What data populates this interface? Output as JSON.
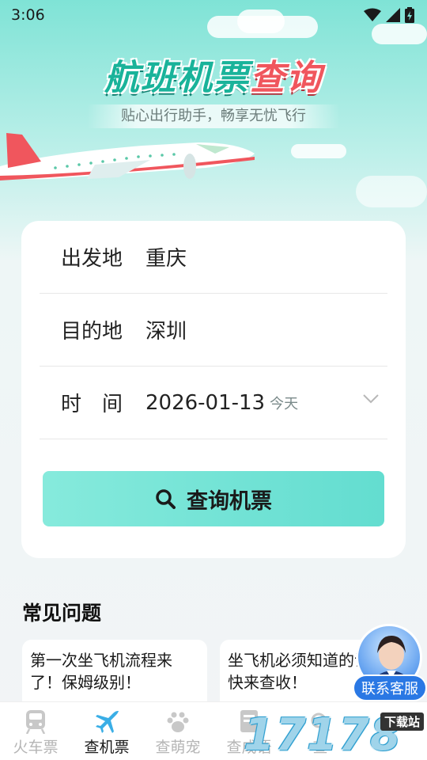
{
  "status_bar": {
    "time": "3:06"
  },
  "hero": {
    "title_part1": "航班机票",
    "title_part2": "查询",
    "subtitle": "贴心出行助手，畅享无忧飞行"
  },
  "form": {
    "departure": {
      "label": "出发地",
      "value": "重庆"
    },
    "destination": {
      "label": "目的地",
      "value": "深圳"
    },
    "date": {
      "label": "时　间",
      "value": "2026-01-13",
      "tag": "今天"
    },
    "search_button": "查询机票"
  },
  "faq": {
    "title": "常见问题",
    "items": [
      {
        "text": "第一次坐飞机流程来了！保姆级别！"
      },
      {
        "text": "坐飞机必须知道的识！快来查收！"
      }
    ]
  },
  "support": {
    "label": "联系客服"
  },
  "tabbar": {
    "items": [
      {
        "label": "火车票",
        "icon": "train-icon",
        "active": false
      },
      {
        "label": "查机票",
        "icon": "airplane-icon",
        "active": true
      },
      {
        "label": "查萌宠",
        "icon": "paw-icon",
        "active": false
      },
      {
        "label": "查成语",
        "icon": "book-icon",
        "active": false
      },
      {
        "label": "查",
        "icon": "search-icon",
        "active": false
      }
    ]
  },
  "watermark": {
    "text": "17178",
    "tag": "下载站"
  },
  "colors": {
    "accent": "#63ddd0",
    "brand_red": "#f0565d",
    "support_blue": "#2a78e4"
  }
}
